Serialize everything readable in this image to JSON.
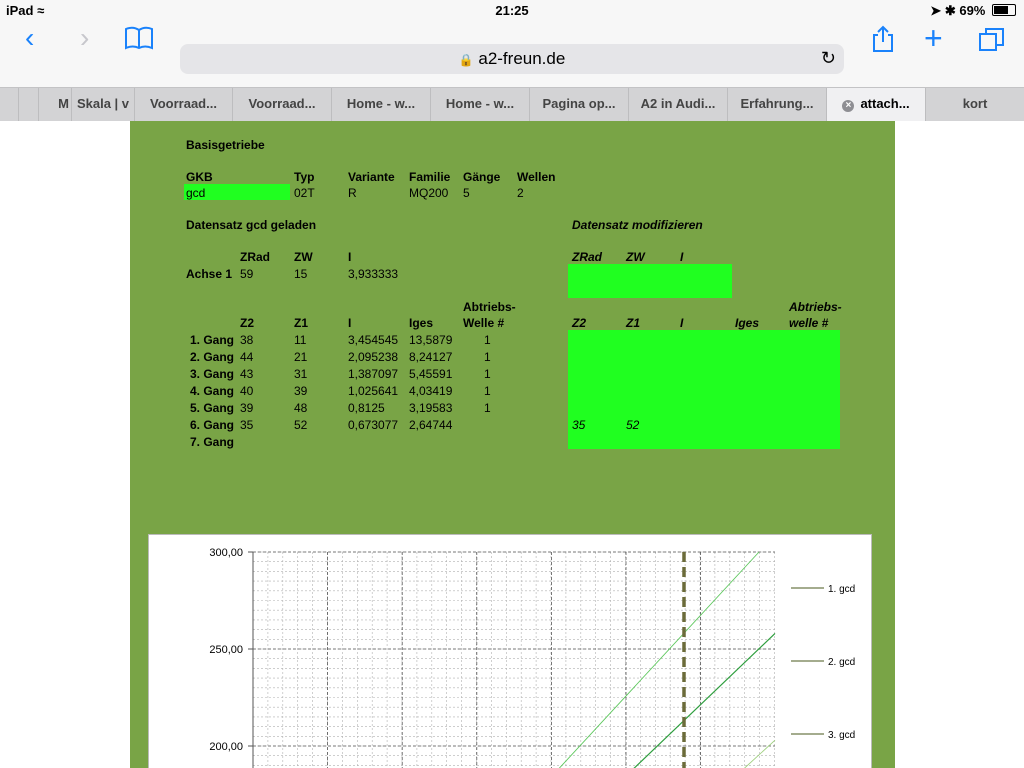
{
  "status": {
    "device": "iPad",
    "time": "21:25",
    "battery": "69%",
    "battery_fraction": 0.69
  },
  "browser": {
    "url": "a2-freun.de",
    "tabs": [
      {
        "label": ""
      },
      {
        "label": ""
      },
      {
        "label": "M"
      },
      {
        "label": "Skala | v"
      },
      {
        "label": "Voorraad..."
      },
      {
        "label": "Voorraad..."
      },
      {
        "label": "Home - w..."
      },
      {
        "label": "Home - w..."
      },
      {
        "label": "Pagina op..."
      },
      {
        "label": "A2 in Audi..."
      },
      {
        "label": "Erfahrung..."
      },
      {
        "label": "attach..."
      },
      {
        "label": "kort"
      }
    ]
  },
  "sheet": {
    "title": "Basisgetriebe",
    "info_headers": [
      "GKB",
      "Typ",
      "Variante",
      "Familie",
      "Gänge",
      "Wellen"
    ],
    "info_values": [
      "gcd",
      "02T",
      "R",
      "MQ200",
      "5",
      "2"
    ],
    "loaded_title": "Datensatz gcd geladen",
    "modify_title": "Datensatz modifizieren",
    "axis_headers": [
      "ZRad",
      "ZW",
      "I"
    ],
    "axis_row": {
      "label": "Achse 1",
      "zrad": "59",
      "zw": "15",
      "i": "3,933333"
    },
    "gear_headers": [
      "Z2",
      "Z1",
      "I",
      "Iges",
      "Abtriebs-",
      "Welle #"
    ],
    "gears": [
      {
        "label": "1. Gang",
        "z2": "38",
        "z1": "11",
        "i": "3,454545",
        "iges": "13,5879",
        "welle": "1"
      },
      {
        "label": "2. Gang",
        "z2": "44",
        "z1": "21",
        "i": "2,095238",
        "iges": "8,24127",
        "welle": "1"
      },
      {
        "label": "3. Gang",
        "z2": "43",
        "z1": "31",
        "i": "1,387097",
        "iges": "5,45591",
        "welle": "1"
      },
      {
        "label": "4. Gang",
        "z2": "40",
        "z1": "39",
        "i": "1,025641",
        "iges": "4,03419",
        "welle": "1"
      },
      {
        "label": "5. Gang",
        "z2": "39",
        "z1": "48",
        "i": "0,8125",
        "iges": "3,19583",
        "welle": "1"
      },
      {
        "label": "6. Gang",
        "z2": "35",
        "z1": "52",
        "i": "0,673077",
        "iges": "2,64744",
        "welle": ""
      },
      {
        "label": "7. Gang",
        "z2": "",
        "z1": "",
        "i": "",
        "iges": "",
        "welle": ""
      }
    ],
    "mod_axis_headers": [
      "ZRad",
      "ZW",
      "I"
    ],
    "mod_gear_headers": [
      "Z2",
      "Z1",
      "I",
      "Iges",
      "Abtriebs-",
      "welle #"
    ],
    "mod_gear6": {
      "z2": "35",
      "z1": "52"
    }
  },
  "chart_data": {
    "type": "line",
    "y_ticks": [
      "300,00",
      "250,00",
      "200,00"
    ],
    "ylim": [
      190,
      300
    ],
    "series": [
      {
        "name": "1. gcd",
        "color": "#5ec85e"
      },
      {
        "name": "2. gcd",
        "color": "#2e9e3e"
      },
      {
        "name": "3. gcd",
        "color": "#9fd07f"
      }
    ]
  }
}
